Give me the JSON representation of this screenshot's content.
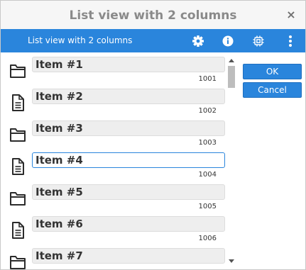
{
  "window": {
    "title": "List view with 2 columns",
    "close_glyph": "×"
  },
  "toolbar": {
    "title": "List view with 2 columns",
    "buttons": [
      "gear-icon",
      "info-icon",
      "chip-icon",
      "more-vertical-icon"
    ],
    "accent": "#2a85dc"
  },
  "list": {
    "selected_index": 3,
    "items": [
      {
        "name": "Item #1",
        "value": "1001",
        "icon": "folder-icon"
      },
      {
        "name": "Item #2",
        "value": "1002",
        "icon": "document-icon"
      },
      {
        "name": "Item #3",
        "value": "1003",
        "icon": "folder-icon"
      },
      {
        "name": "Item #4",
        "value": "1004",
        "icon": "document-icon"
      },
      {
        "name": "Item #5",
        "value": "1005",
        "icon": "folder-icon"
      },
      {
        "name": "Item #6",
        "value": "1006",
        "icon": "document-icon"
      },
      {
        "name": "Item #7",
        "value": "",
        "icon": "folder-icon"
      }
    ]
  },
  "dialog": {
    "ok_label": "OK",
    "cancel_label": "Cancel"
  }
}
